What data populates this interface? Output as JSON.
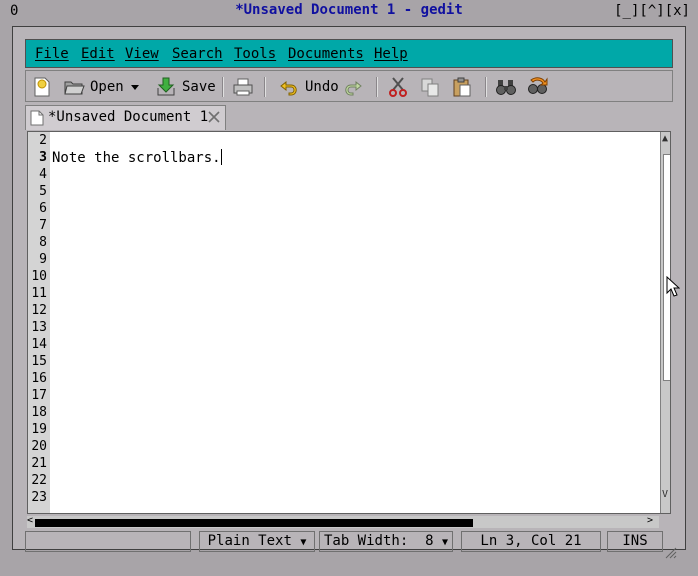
{
  "window": {
    "left_label": "0",
    "title": "*Unsaved Document 1 - gedit",
    "controls": [
      "[_]",
      "[^]",
      "[x]"
    ]
  },
  "menu": [
    "File",
    "Edit",
    "View",
    "Search",
    "Tools",
    "Documents",
    "Help"
  ],
  "toolbar": {
    "open_label": "Open",
    "save_label": "Save",
    "undo_label": "Undo"
  },
  "tab": {
    "label": "*Unsaved Document 1"
  },
  "editor": {
    "line_numbers": [
      "2",
      "3",
      "4",
      "5",
      "6",
      "7",
      "8",
      "9",
      "10",
      "11",
      "12",
      "13",
      "14",
      "15",
      "16",
      "17",
      "18",
      "19",
      "20",
      "21",
      "22",
      "23"
    ],
    "current_line": "3",
    "current_text": "Note the scrollbars."
  },
  "status": {
    "language": "Plain Text",
    "tab_width": "Tab Width:  8",
    "position": "Ln 3, Col 21",
    "mode": "INS"
  },
  "colors": {
    "menubar": "#00a8a8",
    "title": "#1010a0",
    "frame": "#b8b4b8"
  }
}
